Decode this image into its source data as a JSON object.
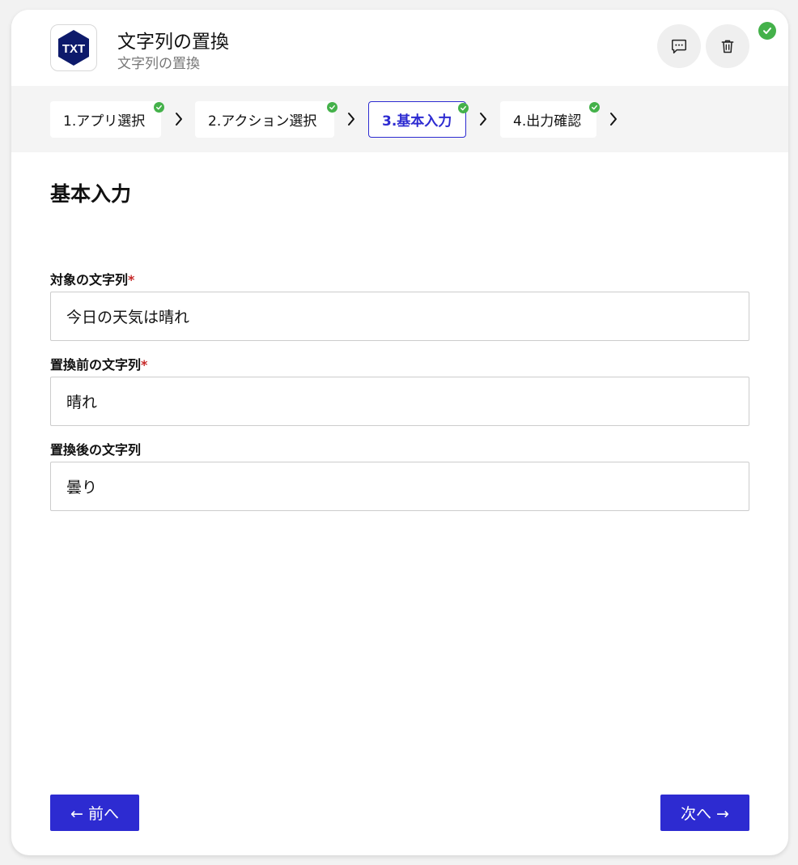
{
  "header": {
    "icon_text": "TXT",
    "title": "文字列の置換",
    "subtitle": "文字列の置換",
    "comment_icon": "comment-icon",
    "trash_icon": "trash-icon",
    "status_icon": "check-circle-icon"
  },
  "steps": [
    {
      "label": "1.アプリ選択",
      "completed": true,
      "active": false
    },
    {
      "label": "2.アクション選択",
      "completed": true,
      "active": false
    },
    {
      "label": "3.基本入力",
      "completed": true,
      "active": true
    },
    {
      "label": "4.出力確認",
      "completed": true,
      "active": false
    }
  ],
  "section": {
    "title": "基本入力"
  },
  "fields": [
    {
      "label": "対象の文字列",
      "required_mark": "*",
      "value": "今日の天気は晴れ"
    },
    {
      "label": "置換前の文字列",
      "required_mark": "*",
      "value": "晴れ"
    },
    {
      "label": "置換後の文字列",
      "required_mark": "",
      "value": "曇り"
    }
  ],
  "nav": {
    "prev_label": "← 前へ",
    "next_label": "次へ →"
  },
  "colors": {
    "accent": "#2d2bd1",
    "success": "#44b14a",
    "required": "#c62828",
    "icon_navy": "#0d1a6b"
  }
}
